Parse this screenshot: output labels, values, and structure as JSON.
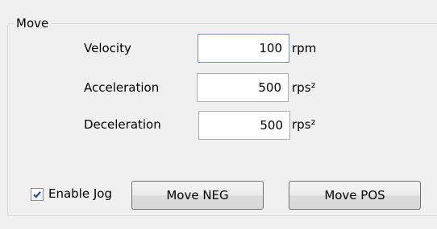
{
  "group": {
    "title": "Move"
  },
  "fields": {
    "velocity": {
      "label": "Velocity",
      "value": "100",
      "unit": "rpm"
    },
    "acceleration": {
      "label": "Acceleration",
      "value": "500",
      "unit": "rps²"
    },
    "deceleration": {
      "label": "Deceleration",
      "value": "500",
      "unit": "rps²"
    }
  },
  "jog": {
    "enable_label": "Enable Jog",
    "enabled": true,
    "move_neg_label": "Move NEG",
    "move_pos_label": "Move POS"
  }
}
